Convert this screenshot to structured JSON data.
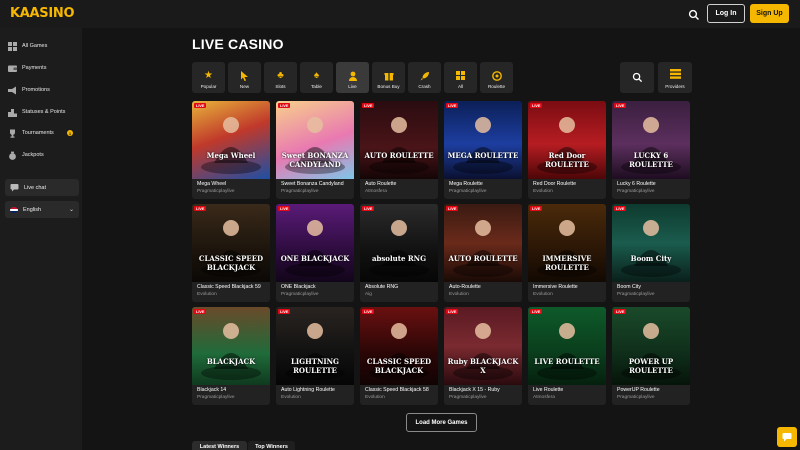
{
  "brand": {
    "logo_text": "KAASINO",
    "accent": "#f5b700",
    "live_red": "#e30613"
  },
  "header": {
    "login_label": "Log In",
    "signup_label": "Sign Up",
    "search_icon": "search-icon"
  },
  "sidebar": {
    "items": [
      {
        "label": "All Games",
        "icon": "grid-icon"
      },
      {
        "label": "Payments",
        "icon": "wallet-icon"
      },
      {
        "label": "Promotions",
        "icon": "megaphone-icon"
      },
      {
        "label": "Statuses & Points",
        "icon": "podium-icon"
      },
      {
        "label": "Tournaments",
        "icon": "trophy-icon",
        "badge": "1"
      },
      {
        "label": "Jackpots",
        "icon": "moneybag-icon"
      }
    ],
    "live_chat": "Live chat",
    "language": "English"
  },
  "main": {
    "title": "LIVE CASINO",
    "categories": [
      {
        "label": "Popular",
        "icon": "star-icon"
      },
      {
        "label": "New",
        "icon": "cursor-icon"
      },
      {
        "label": "Slots",
        "icon": "clover-icon"
      },
      {
        "label": "Table",
        "icon": "spade-icon"
      },
      {
        "label": "Live",
        "icon": "dealer-icon",
        "active": true
      },
      {
        "label": "Bonus Buy",
        "icon": "gift-icon"
      },
      {
        "label": "Crash",
        "icon": "rocket-icon"
      },
      {
        "label": "All",
        "icon": "grid-icon"
      },
      {
        "label": "Roulette",
        "icon": "roulette-icon"
      }
    ],
    "providers_label": "Providers",
    "games": [
      {
        "name": "Mega Wheel",
        "provider": "Pragmaticplaylive",
        "art": "Mega Wheel",
        "bg": "linear-gradient(160deg,#e8b33a,#c0392b 45%,#1d4fa5)"
      },
      {
        "name": "Sweet Bonanza Candyland",
        "provider": "Pragmaticplaylive",
        "art": "Sweet BONANZA CANDYLAND",
        "bg": "linear-gradient(160deg,#f7d08a,#e979b1 55%,#7ec6e8)"
      },
      {
        "name": "Auto Roulette",
        "provider": "Atmosfera",
        "art": "AUTO ROULETTE",
        "bg": "linear-gradient(180deg,#2a0c10,#4a1418 60%,#150506)"
      },
      {
        "name": "Mega Roulette",
        "provider": "Pragmaticplaylive",
        "art": "MEGA ROULETTE",
        "bg": "linear-gradient(180deg,#0b1f57,#1d3ea0 55%,#0a1030)"
      },
      {
        "name": "Red Door Roulette",
        "provider": "Evolution",
        "art": "Red Door ROULETTE",
        "bg": "linear-gradient(180deg,#7a0c12,#b61d22 55%,#4d0608)"
      },
      {
        "name": "Lucky 6 Roulette",
        "provider": "Pragmaticplaylive",
        "art": "LUCKY 6 ROULETTE",
        "bg": "linear-gradient(180deg,#3a1f3f,#5c2f5e 55%,#1e0d21)"
      },
      {
        "name": "Classic Speed Blackjack 59",
        "provider": "Evolution",
        "art": "CLASSIC SPEED BLACKJACK",
        "bg": "linear-gradient(180deg,#3a2a1a,#1c140c 60%,#0b0805)"
      },
      {
        "name": "ONE Blackjack",
        "provider": "Pragmaticplaylive",
        "art": "ONE BLACKJACK",
        "bg": "linear-gradient(180deg,#5a1b78,#2d0c3e 60%,#12051a)"
      },
      {
        "name": "Absolute RNG",
        "provider": "Aig",
        "art": "absolute RNG",
        "bg": "linear-gradient(180deg,#2b2b2b,#111 60%,#060606)"
      },
      {
        "name": "Auto-Roulette",
        "provider": "Evolution",
        "art": "AUTO ROULETTE",
        "bg": "linear-gradient(180deg,#3a1a12,#6a2a1a 50%,#1a0a06)"
      },
      {
        "name": "Immersive Roulette",
        "provider": "Evolution",
        "art": "IMMERSIVE ROULETTE",
        "bg": "linear-gradient(180deg,#4a2a0a,#2a1606 60%,#120902)"
      },
      {
        "name": "Boom City",
        "provider": "Pragmaticplaylive",
        "art": "Boom City",
        "bg": "linear-gradient(180deg,#0e3a2e,#1a5c4e 50%,#0a1f1a)"
      },
      {
        "name": "Blackjack 14",
        "provider": "Pragmaticplaylive",
        "art": "BLACKJACK",
        "bg": "linear-gradient(180deg,#6a4a2a,#1f6b3a 60%,#0f3a1e)"
      },
      {
        "name": "Auto Lightning Roulette",
        "provider": "Evolution",
        "art": "LIGHTNING ROULETTE",
        "bg": "linear-gradient(180deg,#2a2420,#111 60%,#050505)"
      },
      {
        "name": "Classic Speed Blackjack 58",
        "provider": "Evolution",
        "art": "CLASSIC SPEED BLACKJACK",
        "bg": "linear-gradient(180deg,#6a1010,#2a0606 60%,#120303)"
      },
      {
        "name": "Blackjack X 15 - Ruby",
        "provider": "Pragmaticplaylive",
        "art": "Ruby BLACKJACK X",
        "bg": "linear-gradient(180deg,#5a1a22,#7a2a30 50%,#2a0a0e)"
      },
      {
        "name": "Live Roulette",
        "provider": "Atmosfera",
        "art": "LIVE ROULETTE",
        "bg": "linear-gradient(180deg,#0e5a2a,#0a3d1c 60%,#05200e)"
      },
      {
        "name": "PowerUP Roulette",
        "provider": "Pragmaticplaylive",
        "art": "POWER UP ROULETTE",
        "bg": "linear-gradient(180deg,#1a4a2a,#0f2e1a 60%,#061409)"
      }
    ],
    "load_more_label": "Load More Games",
    "tabs": [
      {
        "label": "Latest Winners"
      },
      {
        "label": "Top Winners"
      }
    ],
    "live_tag": "LIVE"
  }
}
